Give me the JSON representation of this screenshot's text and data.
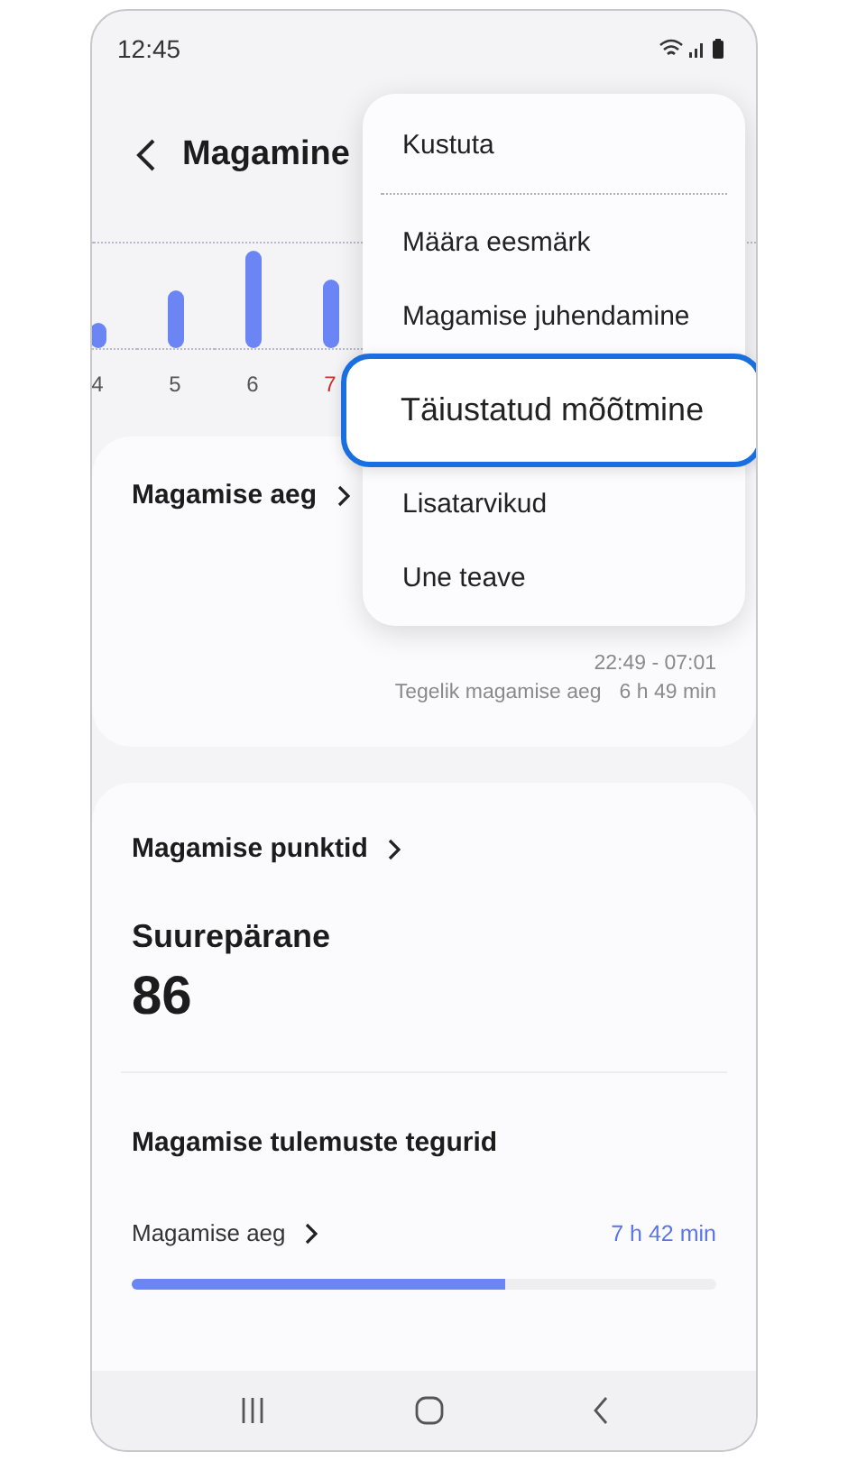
{
  "status_bar": {
    "time": "12:45"
  },
  "header": {
    "title": "Magamine"
  },
  "chart": {
    "day_labels": [
      {
        "label": "4",
        "highlighted": false
      },
      {
        "label": "5",
        "highlighted": false
      },
      {
        "label": "6",
        "highlighted": false
      },
      {
        "label": "7",
        "highlighted": true
      }
    ]
  },
  "menu": {
    "items": [
      {
        "label": "Kustuta",
        "highlighted": false,
        "divider_after": true
      },
      {
        "label": "Määra eesmärk",
        "highlighted": false,
        "divider_after": false
      },
      {
        "label": "Magamise juhendamine",
        "highlighted": false,
        "divider_after": false
      },
      {
        "label": "Täiustatud mõõtmine",
        "highlighted": true,
        "divider_after": false
      },
      {
        "label": "Lisatarvikud",
        "highlighted": false,
        "divider_after": false
      },
      {
        "label": "Une teave",
        "highlighted": false,
        "divider_after": false
      }
    ]
  },
  "sleep_time_card": {
    "title": "Magamise aeg",
    "range": "22:49 - 07:01",
    "actual_label": "Tegelik magamise aeg",
    "actual_value": "6 h 49 min"
  },
  "score_card": {
    "title": "Magamise punktid",
    "rating": "Suurepärane",
    "score": "86",
    "factors_title": "Magamise tulemuste tegurid",
    "factors": [
      {
        "label": "Magamise aeg",
        "value": "7 h 42 min",
        "level": 0.64
      }
    ]
  },
  "nav_bar": {
    "buttons": [
      {
        "kind": "recent"
      },
      {
        "kind": "home"
      },
      {
        "kind": "back"
      }
    ]
  }
}
